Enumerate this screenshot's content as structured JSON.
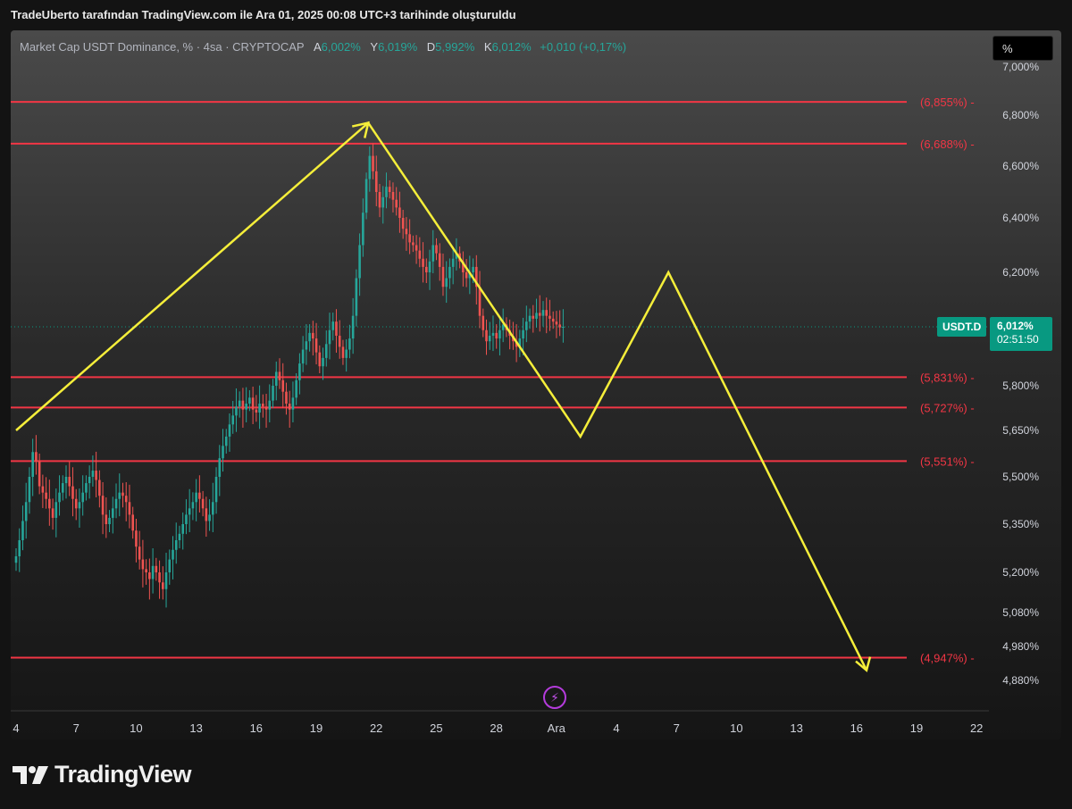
{
  "header": {
    "caption": "TradeUberto tarafından TradingView.com ile Ara 01, 2025 00:08 UTC+3 tarihinde oluşturuldu"
  },
  "legend": {
    "title": "Market Cap USDT Dominance, % · 4sa · CRYPTOCAP",
    "o_label": "A",
    "o_value": "6,002%",
    "h_label": "Y",
    "h_value": "6,019%",
    "l_label": "D",
    "l_value": "5,992%",
    "c_label": "K",
    "c_value": "6,012%",
    "change": "+0,010 (+0,17%)"
  },
  "unit_selector": "%",
  "symbol_tag": "USDT.D",
  "last_price": "6,012%",
  "countdown": "02:51:50",
  "brand": "TradingView",
  "colors": {
    "up": "#26a69a",
    "down": "#ef5350",
    "level_line": "#f23645",
    "projection": "#f5ee3a",
    "brand_accent": "#089981"
  },
  "chart_data": {
    "type": "candlestick",
    "symbol": "USDT.D",
    "timeframe": "4sa",
    "ylim": [
      4.8,
      7.0
    ],
    "x_ticks": [
      "4",
      "7",
      "10",
      "13",
      "16",
      "19",
      "22",
      "25",
      "28",
      "Ara",
      "4",
      "7",
      "10",
      "13",
      "16",
      "19",
      "22"
    ],
    "y_ticks": [
      "7,000%",
      "6,800%",
      "6,600%",
      "6,400%",
      "6,200%",
      "5,800%",
      "5,650%",
      "5,500%",
      "5,350%",
      "5,200%",
      "5,080%",
      "4,980%",
      "4,880%"
    ],
    "y_tick_values": [
      7.0,
      6.8,
      6.6,
      6.4,
      6.2,
      5.8,
      5.65,
      5.5,
      5.35,
      5.2,
      5.08,
      4.98,
      4.88
    ],
    "levels": [
      {
        "label": "(6,855%)",
        "value": 6.855
      },
      {
        "label": "(6,688%)",
        "value": 6.688
      },
      {
        "label": "(5,831%)",
        "value": 5.831
      },
      {
        "label": "(5,727%)",
        "value": 5.727
      },
      {
        "label": "(5,551%)",
        "value": 5.551
      },
      {
        "label": "(4,947%)",
        "value": 4.947
      }
    ],
    "last_value": 6.012,
    "candle_start": "4",
    "candle_step_days": 0.1667,
    "candle_closes": [
      5.25,
      5.3,
      5.36,
      5.42,
      5.5,
      5.58,
      5.55,
      5.47,
      5.45,
      5.43,
      5.4,
      5.37,
      5.42,
      5.45,
      5.48,
      5.5,
      5.47,
      5.43,
      5.4,
      5.42,
      5.45,
      5.48,
      5.5,
      5.52,
      5.49,
      5.44,
      5.38,
      5.35,
      5.37,
      5.4,
      5.43,
      5.45,
      5.44,
      5.42,
      5.38,
      5.33,
      5.28,
      5.24,
      5.21,
      5.2,
      5.18,
      5.22,
      5.2,
      5.17,
      5.15,
      5.2,
      5.24,
      5.27,
      5.3,
      5.32,
      5.35,
      5.38,
      5.4,
      5.42,
      5.45,
      5.43,
      5.4,
      5.36,
      5.38,
      5.42,
      5.5,
      5.56,
      5.6,
      5.63,
      5.67,
      5.7,
      5.73,
      5.75,
      5.72,
      5.74,
      5.76,
      5.72,
      5.71,
      5.74,
      5.73,
      5.72,
      5.75,
      5.8,
      5.85,
      5.82,
      5.78,
      5.74,
      5.72,
      5.76,
      5.82,
      5.88,
      5.93,
      5.96,
      5.99,
      5.97,
      5.92,
      5.87,
      5.9,
      5.95,
      6.0,
      6.03,
      5.98,
      5.94,
      5.9,
      5.93,
      5.97,
      6.05,
      6.18,
      6.3,
      6.42,
      6.55,
      6.64,
      6.58,
      6.5,
      6.44,
      6.48,
      6.52,
      6.5,
      6.47,
      6.44,
      6.4,
      6.36,
      6.34,
      6.31,
      6.3,
      6.28,
      6.25,
      6.22,
      6.2,
      6.24,
      6.3,
      6.27,
      6.22,
      6.15,
      6.18,
      6.22,
      6.25,
      6.27,
      6.24,
      6.2,
      6.18,
      6.2,
      6.22,
      6.15,
      6.05,
      6.0,
      5.96,
      5.98,
      5.99,
      5.97,
      6.0,
      6.02,
      6.0,
      5.98,
      5.96,
      5.94,
      5.97,
      6.0,
      6.03,
      6.05,
      6.04,
      6.06,
      6.05,
      6.07,
      6.05,
      6.04,
      6.03,
      6.02,
      6.01,
      6.012
    ],
    "projection_path": [
      {
        "x": "4",
        "y": 5.65
      },
      {
        "x": "21.6",
        "y": 6.77
      },
      {
        "x": "Ara+1.2",
        "y": 5.63
      },
      {
        "x": "Ara+5.6",
        "y": 6.2
      },
      {
        "x": "Ara+15.5",
        "y": 4.91
      }
    ]
  }
}
